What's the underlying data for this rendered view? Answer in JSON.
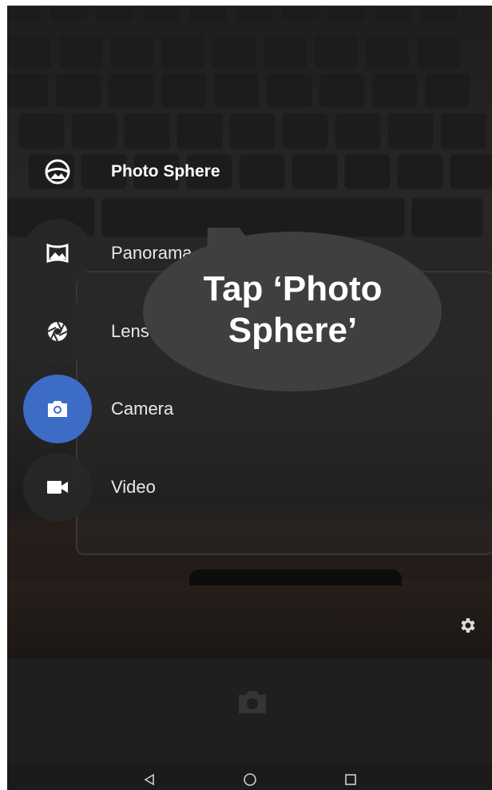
{
  "modes": [
    {
      "label": "Photo Sphere",
      "icon": "photo-sphere-icon",
      "highlighted": true
    },
    {
      "label": "Panorama",
      "icon": "panorama-icon",
      "highlighted": false
    },
    {
      "label": "Lens Blur",
      "icon": "lens-blur-icon",
      "highlighted": false
    },
    {
      "label": "Camera",
      "icon": "camera-icon",
      "highlighted": false,
      "active": true
    },
    {
      "label": "Video",
      "icon": "video-icon",
      "highlighted": false
    }
  ],
  "callout": {
    "line1": "Tap ‘Photo",
    "line2": "Sphere’"
  },
  "settings": {
    "icon": "gear-icon"
  },
  "shutter": {
    "icon": "camera-shutter-icon"
  },
  "navbar": {
    "back": "back-icon",
    "home": "home-icon",
    "recents": "recents-icon"
  },
  "colors": {
    "active_mode": "#3d6cc7",
    "callout_fill": "#3f3f3f",
    "background": "#1e1e1e"
  }
}
